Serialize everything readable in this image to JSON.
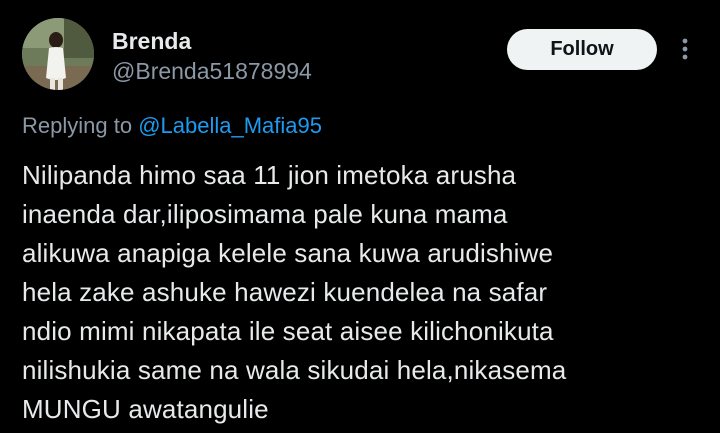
{
  "author": {
    "display_name": "Brenda",
    "handle": "@Brenda51878994",
    "avatar_icon": "profile-photo"
  },
  "actions": {
    "follow_label": "Follow",
    "more_icon": "more-options-icon"
  },
  "reply_context": {
    "prefix": "Replying to",
    "mention": "@Labella_Mafia95"
  },
  "tweet": {
    "lines": [
      "Nilipanda himo saa 11 jion imetoka arusha",
      "inaenda dar,iliposimama pale kuna mama",
      "alikuwa anapiga kelele sana kuwa arudishiwe",
      "hela zake ashuke hawezi kuendelea na safar",
      "ndio mimi nikapata ile seat aisee kilichonikuta",
      "nilishukia same na wala sikudai hela,nikasema",
      "MUNGU awatangulie"
    ]
  },
  "colors": {
    "background": "#000000",
    "primary_text": "#e7e9ea",
    "secondary_text": "#8b98a5",
    "link": "#1d9bf0",
    "follow_button_bg": "#eff3f4"
  }
}
